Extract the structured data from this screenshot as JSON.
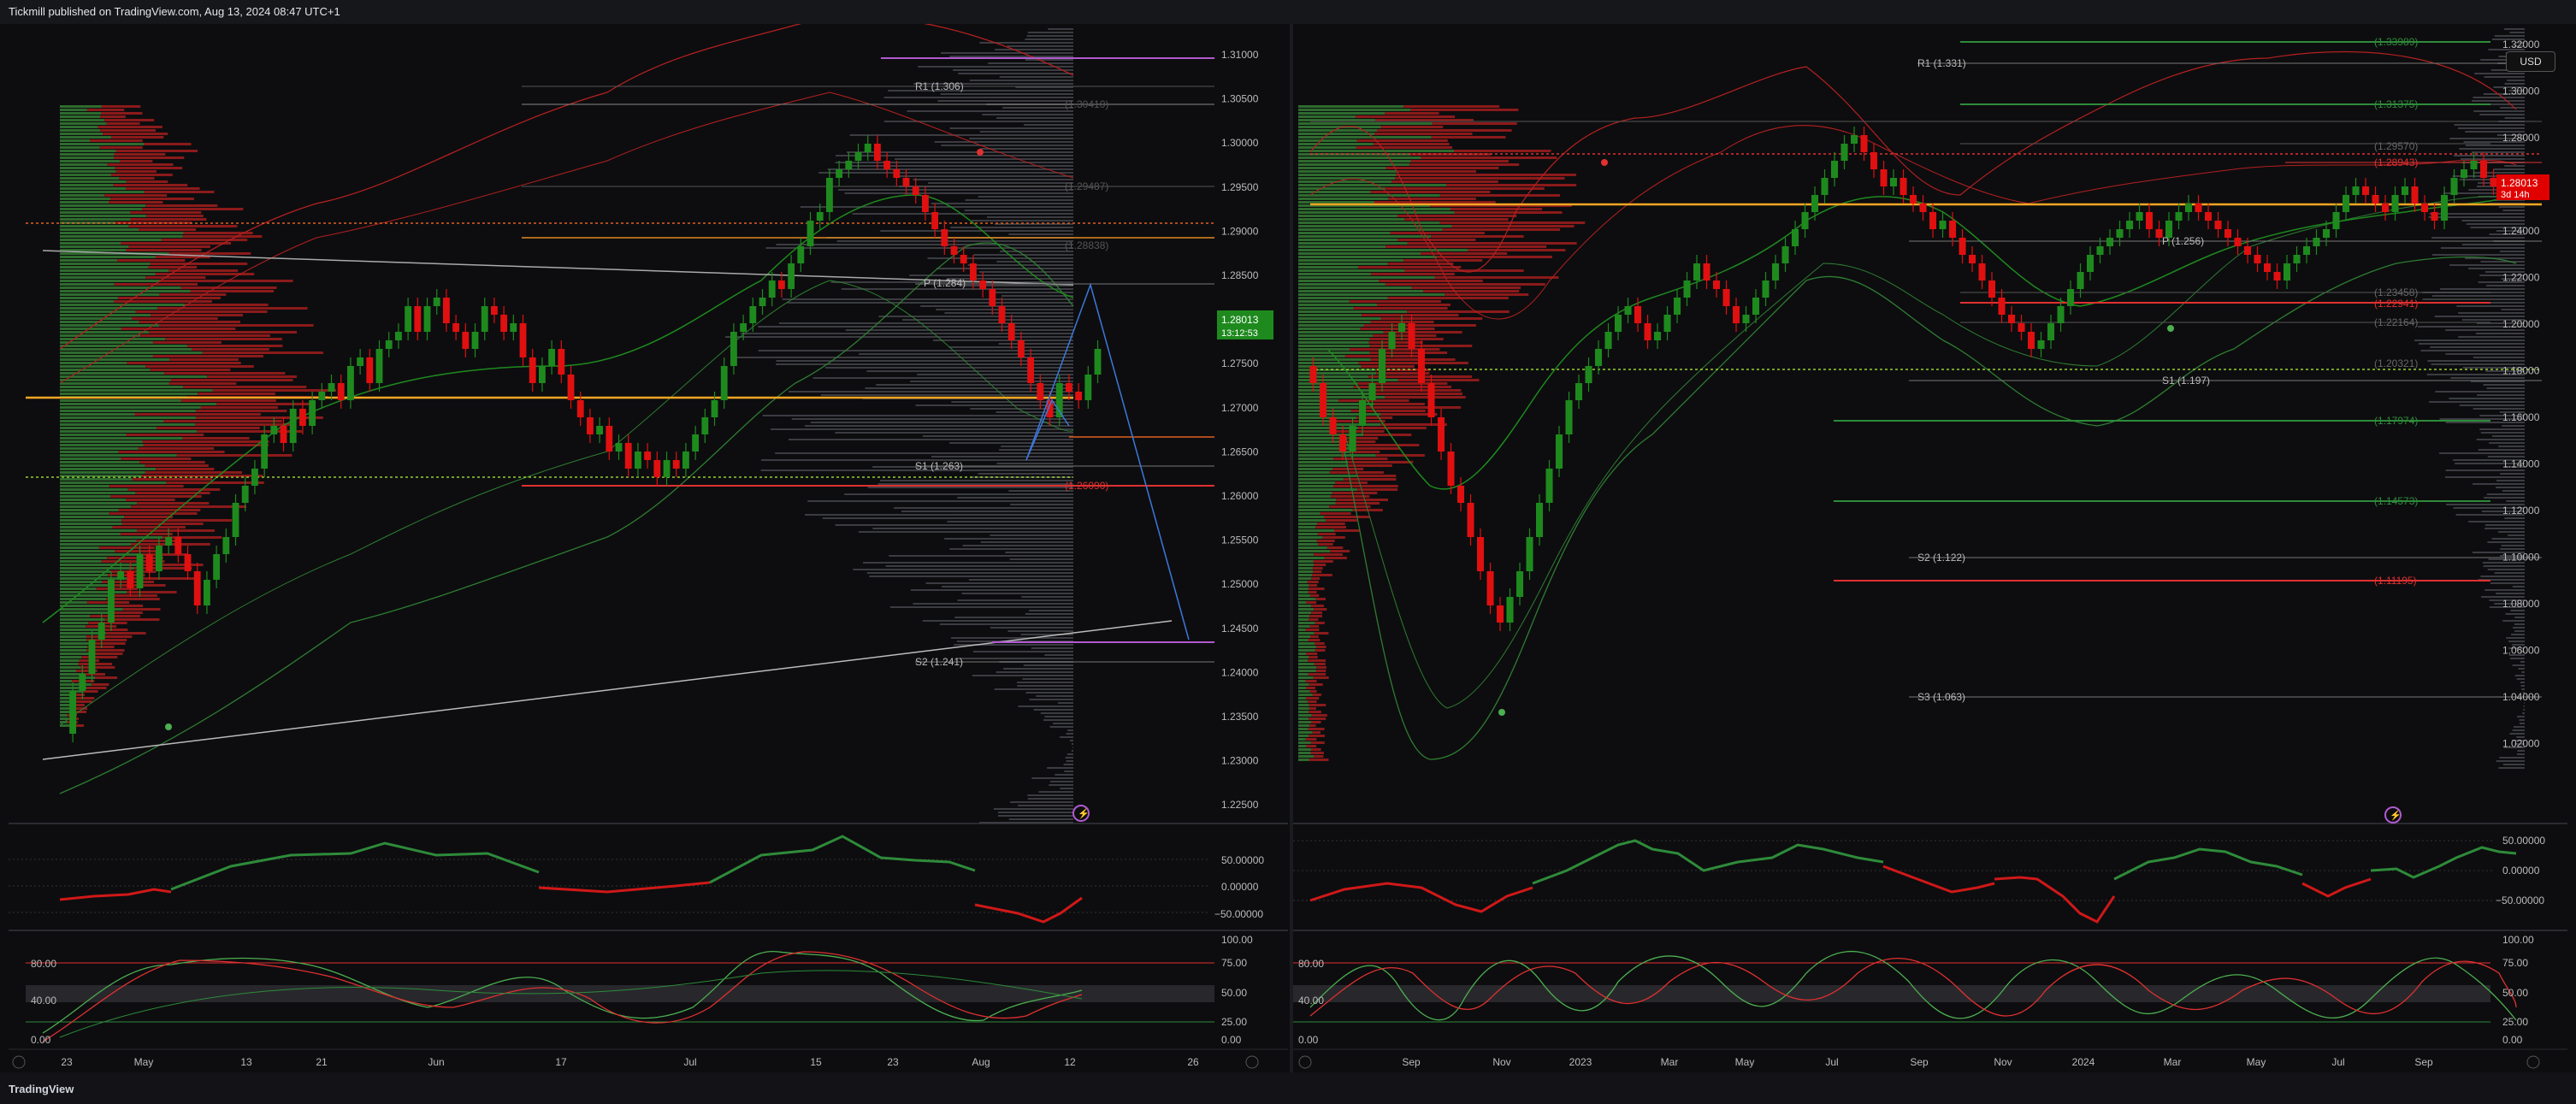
{
  "header": {
    "publish_info": "Tickmill published on TradingView.com, Aug 13, 2024 08:47 UTC+1"
  },
  "footer": {
    "brand": "TradingView"
  },
  "left_chart": {
    "price_ticks": [
      "1.31000",
      "1.30500",
      "1.30000",
      "1.29500",
      "1.29000",
      "1.28500",
      "1.28000",
      "1.27500",
      "1.27000",
      "1.26500",
      "1.26000",
      "1.25500",
      "1.25000",
      "1.24500",
      "1.24000",
      "1.23500",
      "1.23000",
      "1.22500"
    ],
    "last_price": "1.28013",
    "countdown": "13:12:53",
    "pivot_labels": {
      "r1": "R1 (1.306)",
      "p": "P (1.284)",
      "s1": "S1 (1.263)",
      "s2": "S2 (1.241)"
    },
    "level_labels": [
      "(1.30410)",
      "(1.29487)",
      "(1.28838)",
      "(1.26090)"
    ],
    "time_ticks": [
      "23",
      "May",
      "13",
      "21",
      "Jun",
      "17",
      "Jul",
      "15",
      "23",
      "Aug",
      "12",
      "26"
    ],
    "osc1_ticks": [
      "50.00000",
      "0.00000",
      "−50.00000"
    ],
    "osc2_left_ticks": [
      "80.00",
      "40.00",
      "0.00"
    ],
    "osc2_right_ticks": [
      "100.00",
      "75.00",
      "50.00",
      "25.00",
      "0.00"
    ]
  },
  "right_chart": {
    "currency": "USD",
    "price_ticks": [
      "1.32000",
      "1.30000",
      "1.28000",
      "1.26000",
      "1.24000",
      "1.22000",
      "1.20000",
      "1.18000",
      "1.16000",
      "1.14000",
      "1.12000",
      "1.10000",
      "1.08000",
      "1.06000",
      "1.04000",
      "1.02000"
    ],
    "last_price": "1.28013",
    "countdown": "3d 14h",
    "pivot_labels": {
      "r1": "R1 (1.331)",
      "p": "P (1.256)",
      "s1": "S1 (1.197)",
      "s2": "S2 (1.122)",
      "s3": "S3 (1.063)"
    },
    "level_labels": [
      "(1.33989)",
      "(1.31375)",
      "(1.29570)",
      "(1.28943)",
      "(1.23458)",
      "(1.22941)",
      "(1.22164)",
      "(1.20321)",
      "(1.17974)",
      "(1.14573)",
      "(1.11195)"
    ],
    "time_ticks": [
      "Sep",
      "Nov",
      "2023",
      "Mar",
      "May",
      "Jul",
      "Sep",
      "Nov",
      "2024",
      "Mar",
      "May",
      "Jul",
      "Sep"
    ],
    "osc1_ticks": [
      "50.00000",
      "0.00000",
      "−50.00000"
    ],
    "osc2_left_ticks": [
      "80.00",
      "40.00",
      "0.00"
    ],
    "osc2_right_ticks": [
      "100.00",
      "75.00",
      "50.00",
      "25.00",
      "0.00"
    ]
  },
  "colors": {
    "up": "#1e8a1e",
    "down": "#d01818",
    "accent_orange": "#f5a623",
    "pivot_red": "#e03030",
    "bg": "#0d0d0f"
  }
}
